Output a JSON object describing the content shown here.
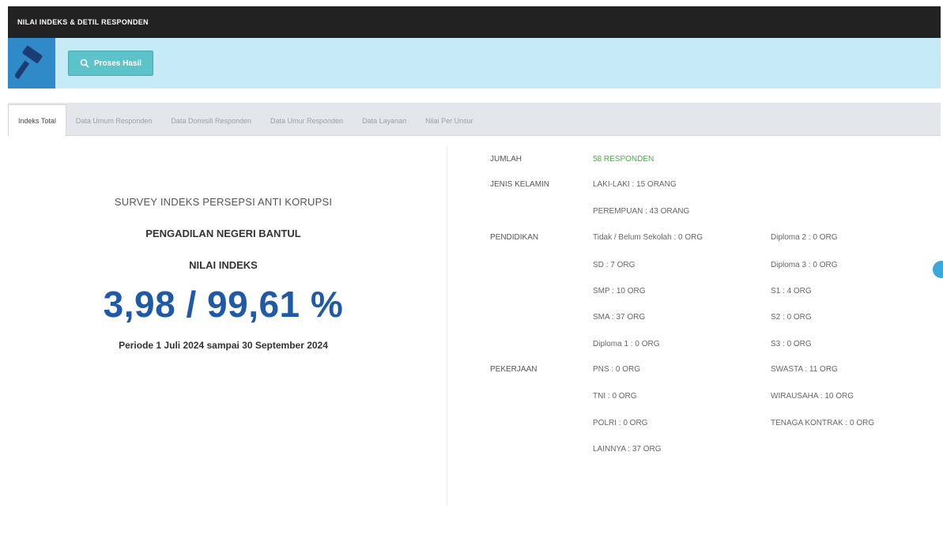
{
  "window": {
    "title": "NILAI INDEKS & DETIL RESPONDEN"
  },
  "toolbar": {
    "button_label": "Proses Hasil"
  },
  "tabs": [
    {
      "label": "Indeks Total",
      "active": true
    },
    {
      "label": "Data Umum Responden",
      "active": false
    },
    {
      "label": "Data Domisili Responden",
      "active": false
    },
    {
      "label": "Data Umur Responden",
      "active": false
    },
    {
      "label": "Data Layanan",
      "active": false
    },
    {
      "label": "Nilai Per Unsur",
      "active": false
    }
  ],
  "summary": {
    "survey_title": "SURVEY INDEKS PERSEPSI ANTI KORUPSI",
    "institution": "PENGADILAN NEGERI BANTUL",
    "index_label": "NILAI INDEKS",
    "index_value": "3,98 / 99,61 %",
    "period": "Periode 1 Juli 2024 sampai 30 September 2024"
  },
  "details": {
    "jumlah_label": "JUMLAH",
    "jumlah_value": "58 RESPONDEN",
    "gender_label": "JENIS KELAMIN",
    "gender": [
      "LAKI-LAKI : 15 ORANG",
      "PEREMPUAN : 43 ORANG"
    ],
    "education_label": "PENDIDIKAN",
    "education_col1": [
      "Tidak / Belum Sekolah : 0 ORG",
      "SD : 7 ORG",
      "SMP : 10 ORG",
      "SMA : 37 ORG",
      "Diploma 1 : 0 ORG"
    ],
    "education_col2": [
      "Diploma 2 : 0 ORG",
      "Diploma 3 : 0 ORG",
      "S1 : 4 ORG",
      "S2 : 0 ORG",
      "S3 : 0 ORG"
    ],
    "job_label": "PEKERJAAN",
    "job_col1": [
      "PNS : 0 ORG",
      "TNI : 0 ORG",
      "POLRI : 0 ORG",
      "LAINNYA : 37 ORG"
    ],
    "job_col2": [
      "SWASTA : 11 ORG",
      "WIRAUSAHA : 10 ORG",
      "TENAGA KONTRAK : 0 ORG"
    ]
  },
  "colors": {
    "accent": "#47b247",
    "index_blue": "#1f5aa8",
    "toolbar_bg": "#c6ebf6",
    "button_bg": "#5bc3c9"
  },
  "icons": [
    "gavel-icon",
    "search-icon"
  ]
}
